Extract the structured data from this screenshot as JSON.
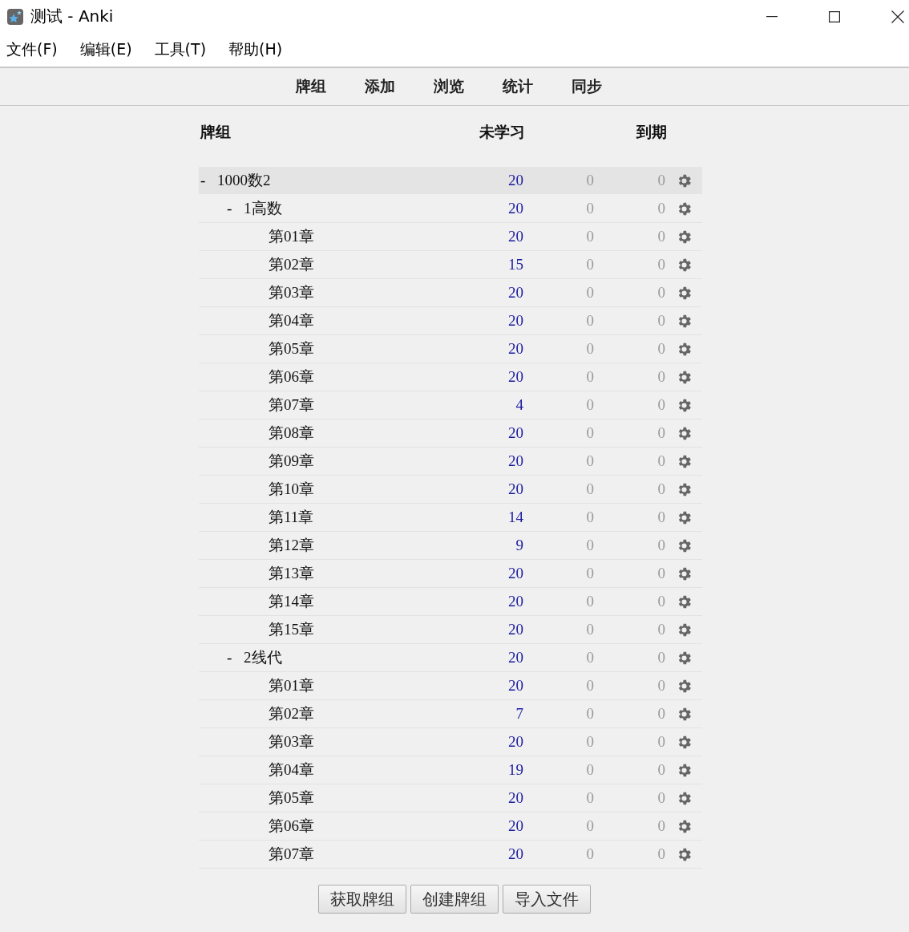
{
  "window": {
    "title": "测试 - Anki"
  },
  "menu": [
    "文件(F)",
    "编辑(E)",
    "工具(T)",
    "帮助(H)"
  ],
  "toolbar": [
    "牌组",
    "添加",
    "浏览",
    "统计",
    "同步"
  ],
  "table": {
    "columns": [
      "牌组",
      "未学习",
      "到期"
    ],
    "decks": [
      {
        "toggle": "-",
        "name": "1000数2",
        "new": "20",
        "column_3": "0",
        "due": "0",
        "selected": true,
        "children": [
          {
            "toggle": "-",
            "name": "1高数",
            "new": "20",
            "column_3": "0",
            "due": "0",
            "selected": false,
            "children": [
              {
                "name": "第01章",
                "new": "20",
                "column_3": "0",
                "due": "0",
                "selected": false
              },
              {
                "name": "第02章",
                "new": "15",
                "column_3": "0",
                "due": "0",
                "selected": false
              },
              {
                "name": "第03章",
                "new": "20",
                "column_3": "0",
                "due": "0",
                "selected": false
              },
              {
                "name": "第04章",
                "new": "20",
                "column_3": "0",
                "due": "0",
                "selected": false
              },
              {
                "name": "第05章",
                "new": "20",
                "column_3": "0",
                "due": "0",
                "selected": false
              },
              {
                "name": "第06章",
                "new": "20",
                "column_3": "0",
                "due": "0",
                "selected": false
              },
              {
                "name": "第07章",
                "new": "4",
                "column_3": "0",
                "due": "0",
                "selected": false
              },
              {
                "name": "第08章",
                "new": "20",
                "column_3": "0",
                "due": "0",
                "selected": false
              },
              {
                "name": "第09章",
                "new": "20",
                "column_3": "0",
                "due": "0",
                "selected": false
              },
              {
                "name": "第10章",
                "new": "20",
                "column_3": "0",
                "due": "0",
                "selected": false
              },
              {
                "name": "第11章",
                "new": "14",
                "column_3": "0",
                "due": "0",
                "selected": false
              },
              {
                "name": "第12章",
                "new": "9",
                "column_3": "0",
                "due": "0",
                "selected": false
              },
              {
                "name": "第13章",
                "new": "20",
                "column_3": "0",
                "due": "0",
                "selected": false
              },
              {
                "name": "第14章",
                "new": "20",
                "column_3": "0",
                "due": "0",
                "selected": false
              },
              {
                "name": "第15章",
                "new": "20",
                "column_3": "0",
                "due": "0",
                "selected": false
              }
            ]
          },
          {
            "toggle": "-",
            "name": "2线代",
            "new": "20",
            "column_3": "0",
            "due": "0",
            "selected": false,
            "children": [
              {
                "name": "第01章",
                "new": "20",
                "column_3": "0",
                "due": "0",
                "selected": false
              },
              {
                "name": "第02章",
                "new": "7",
                "column_3": "0",
                "due": "0",
                "selected": false
              },
              {
                "name": "第03章",
                "new": "20",
                "column_3": "0",
                "due": "0",
                "selected": false
              },
              {
                "name": "第04章",
                "new": "19",
                "column_3": "0",
                "due": "0",
                "selected": false
              },
              {
                "name": "第05章",
                "new": "20",
                "column_3": "0",
                "due": "0",
                "selected": false
              },
              {
                "name": "第06章",
                "new": "20",
                "column_3": "0",
                "due": "0",
                "selected": false
              },
              {
                "name": "第07章",
                "new": "20",
                "column_3": "0",
                "due": "0",
                "selected": false
              }
            ]
          }
        ]
      }
    ]
  },
  "buttons": [
    "获取牌组",
    "创建牌组",
    "导入文件"
  ]
}
